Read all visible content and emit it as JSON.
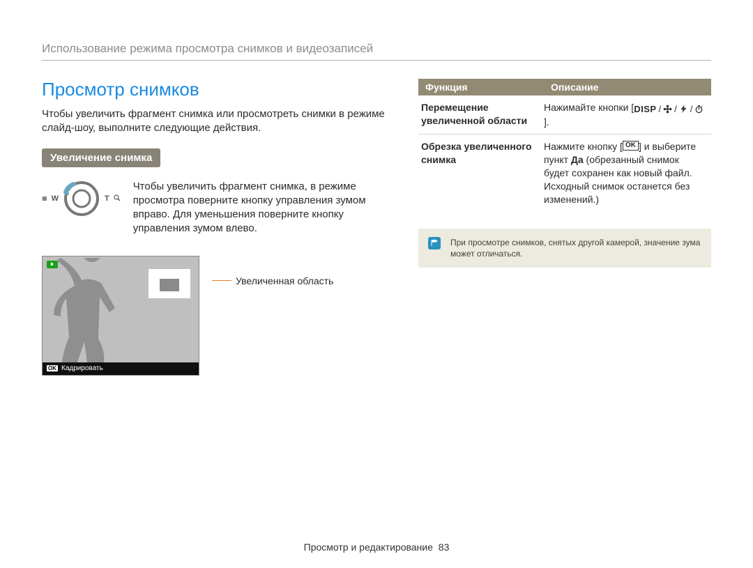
{
  "breadcrumb": "Использование режима просмотра снимков и видеозаписей",
  "section_title": "Просмотр снимков",
  "intro": "Чтобы увеличить фрагмент снимка или просмотреть снимки в режиме слайд-шоу, выполните следующие действия.",
  "subheading": "Увеличение снимка",
  "zoom_text": "Чтобы увеличить фрагмент снимка, в режиме просмотра поверните кнопку управления зумом вправо. Для уменьшения поверните кнопку управления зумом влево.",
  "dial": {
    "w_label": "W",
    "t_label": "T"
  },
  "screenshot": {
    "ok_label": "OK",
    "bottom_label": "Кадрировать"
  },
  "callout": "Увеличенная область",
  "table": {
    "header_function": "Функция",
    "header_description": "Описание",
    "rows": [
      {
        "label": "Перемещение увеличенной области",
        "desc_prefix": "Нажимайте кнопки [",
        "disp": "DISP",
        "desc_suffix": "]."
      },
      {
        "label": "Обрезка увеличенного снимка",
        "desc_prefix": "Нажмите кнопку [",
        "ok": "OK",
        "desc_mid": "] и выберите пункт ",
        "bold": "Да",
        "desc_suffix": " (обрезанный снимок будет сохранен как новый файл. Исходный снимок останется без изменений.)"
      }
    ]
  },
  "note": "При просмотре снимков, снятых другой камерой, значение зума может отличаться.",
  "footer": {
    "text": "Просмотр и редактирование",
    "page": "83"
  }
}
